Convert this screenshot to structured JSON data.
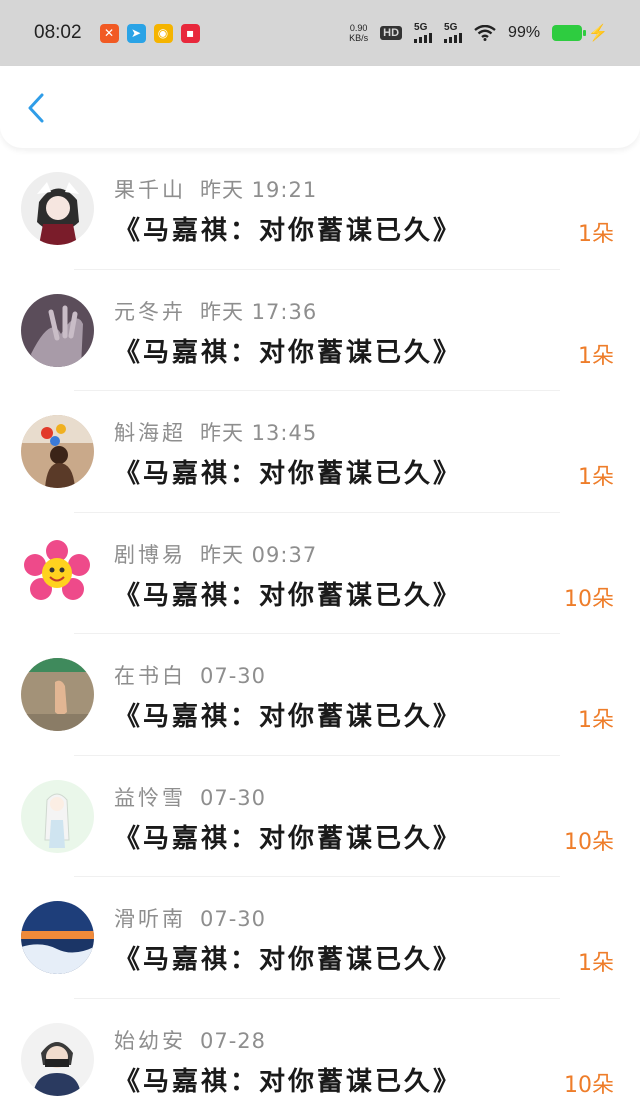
{
  "status_bar": {
    "time": "08:02",
    "net_speed_value": "0.90",
    "net_speed_unit": "KB/s",
    "hd_label": "HD",
    "signal1_label": "5G",
    "signal2_label": "5G",
    "battery_percent": "99%",
    "app_icons": [
      {
        "name": "app-icon-1",
        "color": "#f15a24",
        "glyph": "✕"
      },
      {
        "name": "telegram-icon",
        "color": "#2aa3e6",
        "glyph": "➤"
      },
      {
        "name": "weibo-icon",
        "color": "#f5b400",
        "glyph": "◉"
      },
      {
        "name": "xiaohongshu-icon",
        "color": "#e8283c",
        "glyph": "▪"
      }
    ]
  },
  "header": {
    "back_icon": "chevron-left-icon",
    "accent_color": "#2f9de8"
  },
  "items": [
    {
      "name": "果千山",
      "time": "昨天 19:21",
      "title": "《马嘉祺：对你蓄谋已久》",
      "amount": "1朵"
    },
    {
      "name": "元冬卉",
      "time": "昨天 17:36",
      "title": "《马嘉祺：对你蓄谋已久》",
      "amount": "1朵"
    },
    {
      "name": "斛海超",
      "time": "昨天 13:45",
      "title": "《马嘉祺：对你蓄谋已久》",
      "amount": "1朵"
    },
    {
      "name": "剧博易",
      "time": "昨天 09:37",
      "title": "《马嘉祺：对你蓄谋已久》",
      "amount": "10朵"
    },
    {
      "name": "在书白",
      "time": "07-30",
      "title": "《马嘉祺：对你蓄谋已久》",
      "amount": "1朵"
    },
    {
      "name": "益怜雪",
      "time": "07-30",
      "title": "《马嘉祺：对你蓄谋已久》",
      "amount": "10朵"
    },
    {
      "name": "滑听南",
      "time": "07-30",
      "title": "《马嘉祺：对你蓄谋已久》",
      "amount": "1朵"
    },
    {
      "name": "始幼安",
      "time": "07-28",
      "title": "《马嘉祺：对你蓄谋已久》",
      "amount": "10朵"
    }
  ],
  "colors": {
    "amount": "#ee7d2a",
    "meta": "#8e8e8e",
    "title": "#1a1a1a"
  }
}
